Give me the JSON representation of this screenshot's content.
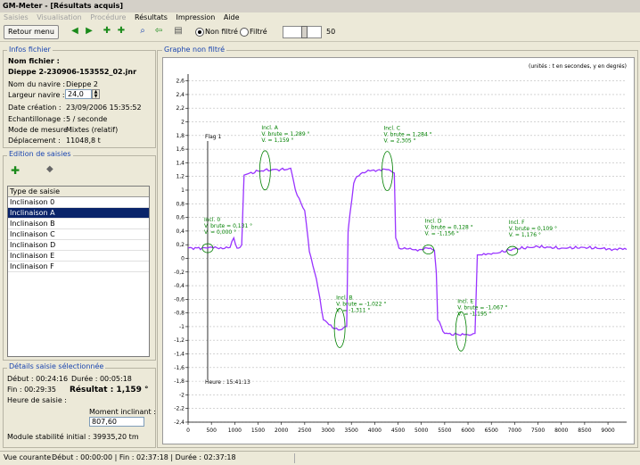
{
  "window": {
    "title": "GM-Meter - [Résultats acquis]"
  },
  "menu": {
    "items": [
      {
        "label": "Saisies",
        "enabled": false
      },
      {
        "label": "Visualisation",
        "enabled": false
      },
      {
        "label": "Procédure",
        "enabled": false
      },
      {
        "label": "Résultats",
        "enabled": true
      },
      {
        "label": "Impression",
        "enabled": true
      },
      {
        "label": "Aide",
        "enabled": true
      }
    ]
  },
  "toolbar": {
    "back_label": "Retour menu",
    "radio_unfiltered": "Non filtré",
    "radio_filtered": "Filtré",
    "slider_value": "50"
  },
  "info": {
    "title": "Infos fichier",
    "file_label": "Nom fichier :",
    "file_name": "Dieppe 2-230906-153552_02.jnr",
    "ship_label": "Nom du navire :",
    "ship_value": "Dieppe 2",
    "width_label": "Largeur navire :",
    "width_value": "24,0",
    "date_label": "Date création :",
    "date_value": "23/09/2006 15:35:52",
    "sampling_label": "Echantillonage :",
    "sampling_value": "5 / seconde",
    "mode_label": "Mode de mesure :",
    "mode_value": "Mixtes (relatif)",
    "displacement_label": "Déplacement :",
    "displacement_value": "11048,8 t"
  },
  "edition": {
    "title": "Edition de saisies",
    "table_header": "Type de saisie",
    "rows": [
      "Inclinaison 0",
      "Inclinaison A",
      "Inclinaison B",
      "Inclinaison C",
      "Inclinaison D",
      "Inclinaison E",
      "Inclinaison F"
    ],
    "selected_index": 1
  },
  "details": {
    "title": "Détails saisie sélectionnée",
    "start": "Début : 00:24:16",
    "duration": "Durée : 00:05:18",
    "end": "Fin :    00:29:35",
    "result": "Résultat : 1,159 °",
    "hour_label": "Heure de saisie :",
    "moment_label": "Moment inclinant :",
    "moment_value": "807,60",
    "stability": "Module stabilité initial :  39935,20 tm"
  },
  "graph": {
    "title": "Graphe non filtré"
  },
  "status": {
    "view": "Vue courante :",
    "range": "Début : 00:00:00 | Fin : 02:37:18 | Durée : 02:37:18"
  },
  "colors": {
    "series": "#9933ff",
    "annotation": "#008000",
    "accent": "#1a45b0"
  },
  "chart_data": {
    "type": "line",
    "unit_note": "(unités : t en secondes, y en degrés)",
    "xlim": [
      0,
      9400
    ],
    "ylim": [
      -2.4,
      2.7
    ],
    "xticks": [
      0,
      500,
      1000,
      1500,
      2000,
      2500,
      3000,
      3500,
      4000,
      4500,
      5000,
      5500,
      6000,
      6500,
      7000,
      7500,
      8000,
      8500,
      9000
    ],
    "yticks": [
      2.6,
      2.4,
      2.2,
      2,
      1.8,
      1.6,
      1.4,
      1.2,
      1,
      0.8,
      0.6,
      0.4,
      0.2,
      0,
      -0.2,
      -0.4,
      -0.6,
      -0.8,
      -1,
      -1.2,
      -1.4,
      -1.6,
      -1.8,
      -2,
      -2.2,
      -2.4
    ],
    "grid": true,
    "series": [
      {
        "x": [
          0,
          420,
          900,
          980,
          1050,
          1150,
          1200,
          1500,
          1800,
          2100,
          2200,
          2300,
          2500,
          2600,
          2750,
          2900,
          3100,
          3300,
          3400,
          3430,
          3550,
          3620,
          3700,
          3900,
          4100,
          4300,
          4420,
          4450,
          4520,
          4600,
          4800,
          5000,
          5200,
          5280,
          5320,
          5350,
          5500,
          5800,
          6000,
          6150,
          6200,
          6300,
          6500,
          7000,
          7500,
          8000,
          8500,
          9000,
          9400
        ],
        "y": [
          0.15,
          0.15,
          0.16,
          0.3,
          0.15,
          0.2,
          1.22,
          1.28,
          1.3,
          1.3,
          1.32,
          1.0,
          0.7,
          0.1,
          -0.3,
          -0.9,
          -1.02,
          -1.04,
          -1.0,
          0.4,
          1.1,
          1.2,
          1.24,
          1.28,
          1.3,
          1.3,
          1.25,
          0.3,
          0.15,
          0.14,
          0.13,
          0.13,
          0.15,
          0.12,
          -0.2,
          -0.9,
          -1.1,
          -1.12,
          -1.12,
          -1.1,
          0.05,
          0.05,
          0.06,
          0.14,
          0.17,
          0.15,
          0.16,
          0.14,
          0.13
        ]
      }
    ],
    "flag": {
      "x": 420,
      "label": "Flag 1",
      "time_label": "Heure : 15:41:13"
    },
    "annotations": [
      {
        "id": "0",
        "x": 420,
        "y": 0.15,
        "lines": [
          "Incl. 0",
          "V. brute = 0,131 °",
          "V. = 0,000 °"
        ]
      },
      {
        "id": "A",
        "x": 1650,
        "y": 1.29,
        "lines": [
          "Incl. A",
          "V. brute = 1,289 °",
          "V. = 1,159 °"
        ]
      },
      {
        "id": "B",
        "x": 3250,
        "y": -1.02,
        "lines": [
          "Incl. B",
          "V. brute = -1,022 °",
          "V. = -1,311 °"
        ]
      },
      {
        "id": "C",
        "x": 4270,
        "y": 1.28,
        "lines": [
          "Incl. C",
          "V. brute = 1,284 °",
          "V. = 2,305 °"
        ]
      },
      {
        "id": "D",
        "x": 5150,
        "y": 0.13,
        "lines": [
          "Incl. D",
          "V. brute = 0,128 °",
          "V. = -1,156 °"
        ]
      },
      {
        "id": "E",
        "x": 5850,
        "y": -1.07,
        "lines": [
          "Incl. E",
          "V. brute = -1,067 °",
          "V. = -1,195 °"
        ]
      },
      {
        "id": "F",
        "x": 6950,
        "y": 0.11,
        "lines": [
          "Incl. F",
          "V. brute = 0,109 °",
          "V. = 1,176 °"
        ]
      }
    ]
  }
}
